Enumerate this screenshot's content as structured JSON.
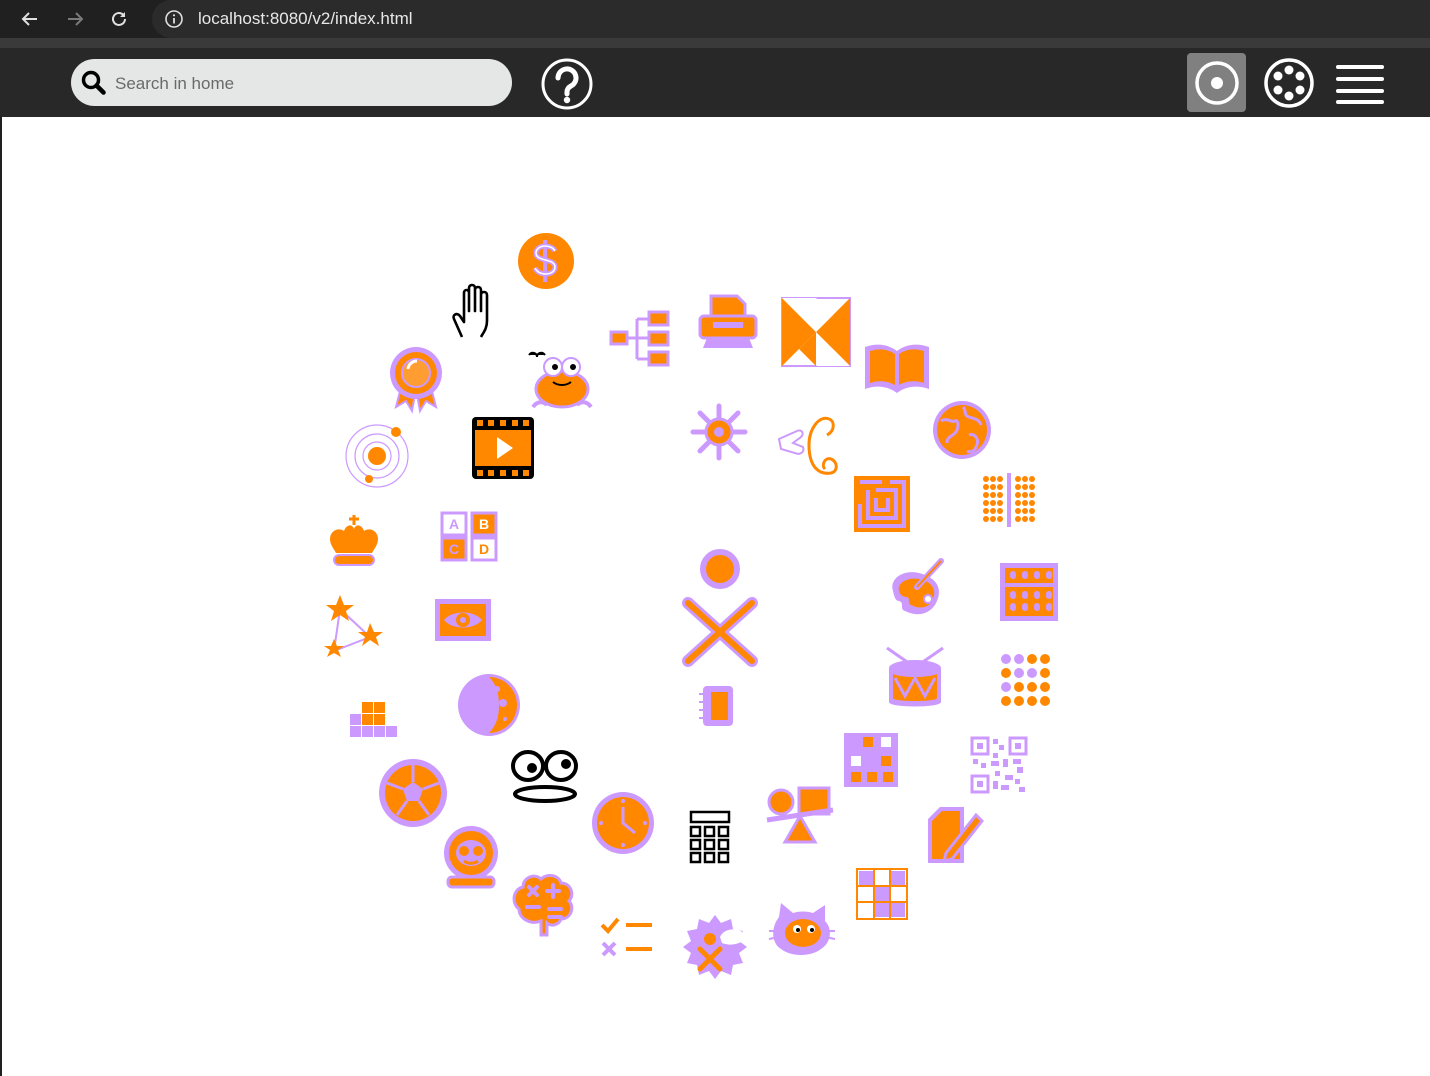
{
  "browser": {
    "url": "localhost:8080/v2/index.html",
    "nav": {
      "back_icon": "arrow-left-icon",
      "forward_icon": "arrow-right-icon",
      "reload_icon": "reload-icon",
      "info_icon": "info-icon"
    }
  },
  "toolbar": {
    "search_placeholder": "Search in home",
    "help_icon": "help-icon",
    "views": [
      {
        "name": "home-view",
        "icon": "home-ring-icon",
        "selected": true
      },
      {
        "name": "neighborhood-view",
        "icon": "neighborhood-icon",
        "selected": false
      },
      {
        "name": "list-view",
        "icon": "list-menu-icon",
        "selected": false
      }
    ]
  },
  "colors": {
    "toolbar_bg": "#282828",
    "browser_bg": "#202020",
    "stroke": "#cc99ff",
    "fill": "#ff8800",
    "active_button": "#808080"
  },
  "home": {
    "buddy_icon": "xo-buddy-icon",
    "journal_icon": "journal-icon",
    "activities": [
      "dollar-icon",
      "hand-icon",
      "award-icon",
      "frog-icon",
      "mindmap-icon",
      "printer-icon",
      "tangram-icon",
      "book-icon",
      "globe-icon",
      "cursive-writing-icon",
      "sparkle-sun-icon",
      "film-play-icon",
      "solar-system-icon",
      "maze-icon",
      "abacus-dots-icon",
      "chess-king-icon",
      "abc-blocks-icon",
      "paint-palette-icon",
      "abacus-frame-icon",
      "constellation-icon",
      "eye-icon",
      "drum-icon",
      "dot-grid-icon",
      "blocks-stack-icon",
      "moon-icon",
      "grid-tiles-icon",
      "qr-code-icon",
      "soccer-ball-icon",
      "eyes-face-icon",
      "clock-icon",
      "calculator-icon",
      "balance-icon",
      "write-icon",
      "astronaut-icon",
      "brain-math-icon",
      "checklist-icon",
      "xo-chat-icon",
      "cat-icon",
      "color-grid-icon"
    ]
  }
}
